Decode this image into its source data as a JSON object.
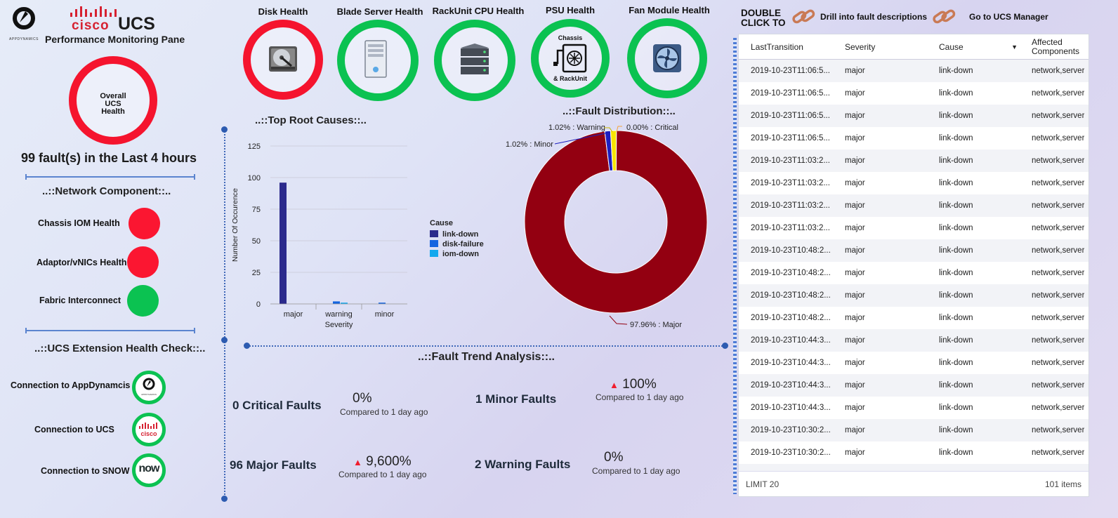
{
  "brand": {
    "appd_logo_text": "APPDYNAMICS",
    "cisco_text": "cisco",
    "ucs_text": "UCS",
    "subtitle": "Performance Monitoring Pane"
  },
  "overall": {
    "label_line1": "Overall",
    "label_line2": "UCS",
    "label_line3": "Health",
    "status_color": "#f5142e"
  },
  "fault_summary": "99 fault(s) in the Last 4 hours",
  "network_component": {
    "title": "..::Network Component::..",
    "items": [
      {
        "label": "Chassis IOM Health",
        "status": "red"
      },
      {
        "label": "Adaptor/vNICs Health",
        "status": "red"
      },
      {
        "label": "Fabric Interconnect",
        "status": "green"
      }
    ]
  },
  "extension_health": {
    "title": "..::UCS Extension Health Check::..",
    "items": [
      {
        "label": "Connection to AppDynamcis",
        "icon": "appdynamics-logo-icon",
        "badge_text": "APPDYNAMICS"
      },
      {
        "label": "Connection to UCS",
        "icon": "cisco-logo-icon",
        "badge_text": "cisco"
      },
      {
        "label": "Connection to SNOW",
        "icon": "servicenow-logo-icon",
        "badge_text": "now"
      }
    ]
  },
  "health_rings": [
    {
      "label": "Disk Health",
      "status": "red",
      "icon": "hard-disk-icon"
    },
    {
      "label": "Blade Server Health",
      "status": "green",
      "icon": "server-tower-icon"
    },
    {
      "label": "RackUnit CPU Health",
      "status": "green",
      "icon": "server-stack-icon"
    },
    {
      "label": "PSU Health",
      "status": "green",
      "icon": "power-supply-icon",
      "inner_top": "Chassis",
      "inner_bottom": "& RackUnit"
    },
    {
      "label": "Fan Module Health",
      "status": "green",
      "icon": "fan-module-icon"
    }
  ],
  "colors": {
    "red": "#f5142e",
    "green": "#0bc251",
    "accent": "#3f68b8"
  },
  "root_causes": {
    "title": "..::Top Root Causes::..",
    "chart_data": {
      "type": "bar",
      "categories": [
        "major",
        "warning",
        "minor"
      ],
      "series": [
        {
          "name": "link-down",
          "values": [
            96,
            0,
            0
          ],
          "color": "#2b2a8c"
        },
        {
          "name": "disk-failure",
          "values": [
            0,
            2,
            1
          ],
          "color": "#1464e0"
        },
        {
          "name": "iom-down",
          "values": [
            0,
            1,
            0
          ],
          "color": "#12a8ee"
        }
      ],
      "title": "",
      "xlabel": "Severity",
      "ylabel": "Number Of Occurence",
      "ylim": [
        0,
        125
      ],
      "yticks": [
        0,
        25,
        50,
        75,
        100,
        125
      ],
      "legend_title": "Cause",
      "legend_position": "right",
      "grid": true
    }
  },
  "fault_distribution": {
    "title": "..::Fault Distribution::..",
    "chart_data": {
      "type": "pie",
      "donut": true,
      "slices": [
        {
          "name": "Major",
          "value": 97.96,
          "label": "97.96% : Major",
          "color": "#930011"
        },
        {
          "name": "Minor",
          "value": 1.02,
          "label": "1.02% : Minor",
          "color": "#1d1fbf"
        },
        {
          "name": "Warning",
          "value": 1.02,
          "label": "1.02% : Warning",
          "color": "#f8e400"
        },
        {
          "name": "Critical",
          "value": 0.0,
          "label": "0.00% : Critical",
          "color": "#f5a33a"
        }
      ]
    }
  },
  "trend": {
    "title": "..::Fault Trend Analysis::..",
    "items": [
      {
        "label": "0 Critical Faults",
        "pct": "0%",
        "up": false,
        "compare": "Compared to 1 day ago"
      },
      {
        "label": "1 Minor Faults",
        "pct": "100%",
        "up": true,
        "compare": "Compared to 1 day ago"
      },
      {
        "label": "96 Major Faults",
        "pct": "9,600%",
        "up": true,
        "compare": "Compared to 1 day ago"
      },
      {
        "label": "2 Warning Faults",
        "pct": "0%",
        "up": false,
        "compare": "Compared to 1 day ago"
      }
    ]
  },
  "double_click": {
    "title_line1": "DOUBLE",
    "title_line2": "CLICK TO",
    "drill_label": "Drill into fault descriptions",
    "manager_label": "Go to UCS Manager"
  },
  "table": {
    "columns": [
      "LastTransition",
      "Severity",
      "Cause",
      "Affected\nComponents"
    ],
    "rows": [
      [
        "2019-10-23T11:06:5...",
        "major",
        "link-down",
        "network,server"
      ],
      [
        "2019-10-23T11:06:5...",
        "major",
        "link-down",
        "network,server"
      ],
      [
        "2019-10-23T11:06:5...",
        "major",
        "link-down",
        "network,server"
      ],
      [
        "2019-10-23T11:06:5...",
        "major",
        "link-down",
        "network,server"
      ],
      [
        "2019-10-23T11:03:2...",
        "major",
        "link-down",
        "network,server"
      ],
      [
        "2019-10-23T11:03:2...",
        "major",
        "link-down",
        "network,server"
      ],
      [
        "2019-10-23T11:03:2...",
        "major",
        "link-down",
        "network,server"
      ],
      [
        "2019-10-23T11:03:2...",
        "major",
        "link-down",
        "network,server"
      ],
      [
        "2019-10-23T10:48:2...",
        "major",
        "link-down",
        "network,server"
      ],
      [
        "2019-10-23T10:48:2...",
        "major",
        "link-down",
        "network,server"
      ],
      [
        "2019-10-23T10:48:2...",
        "major",
        "link-down",
        "network,server"
      ],
      [
        "2019-10-23T10:48:2...",
        "major",
        "link-down",
        "network,server"
      ],
      [
        "2019-10-23T10:44:3...",
        "major",
        "link-down",
        "network,server"
      ],
      [
        "2019-10-23T10:44:3...",
        "major",
        "link-down",
        "network,server"
      ],
      [
        "2019-10-23T10:44:3...",
        "major",
        "link-down",
        "network,server"
      ],
      [
        "2019-10-23T10:44:3...",
        "major",
        "link-down",
        "network,server"
      ],
      [
        "2019-10-23T10:30:2...",
        "major",
        "link-down",
        "network,server"
      ],
      [
        "2019-10-23T10:30:2...",
        "major",
        "link-down",
        "network,server"
      ],
      [
        "2019-10-23T10:30:2...",
        "major",
        "link-down",
        "network,server"
      ]
    ],
    "footer_limit": "LIMIT 20",
    "footer_count": "101 items"
  }
}
